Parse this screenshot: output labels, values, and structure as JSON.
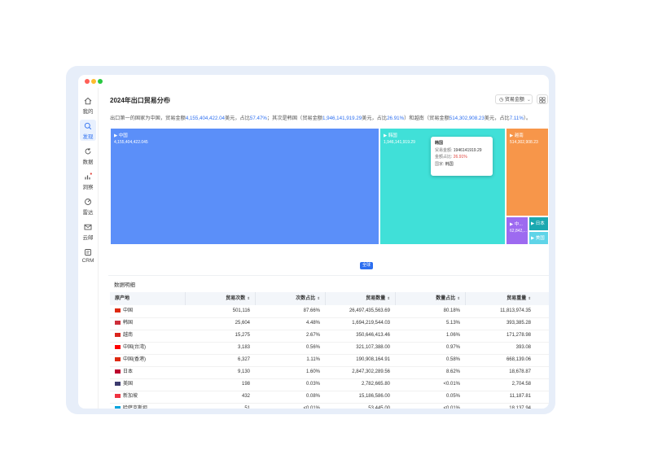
{
  "window": {
    "dots": [
      "#ff5f57",
      "#febc2e",
      "#28c840"
    ]
  },
  "sidebar": {
    "items": [
      {
        "label": "我的",
        "icon": "home-icon"
      },
      {
        "label": "发现",
        "icon": "search-icon",
        "active": true
      },
      {
        "label": "数据",
        "icon": "refresh-icon"
      },
      {
        "label": "洞察",
        "icon": "bar-chart-icon",
        "badge": true
      },
      {
        "label": "雷达",
        "icon": "radar-icon"
      },
      {
        "label": "云邮",
        "icon": "mail-icon"
      },
      {
        "label": "CRM",
        "icon": "crm-icon"
      }
    ]
  },
  "header": {
    "title": "2024年出口贸易分布",
    "select_label": "贸易金额",
    "summary_parts": [
      {
        "t": "出口第一的国家为中国，贸易金额",
        "hl": false
      },
      {
        "t": "4,155,404,422.04",
        "hl": true
      },
      {
        "t": "美元，占比",
        "hl": false
      },
      {
        "t": "57.47%",
        "hl": true
      },
      {
        "t": "；其次是韩国（贸易金额",
        "hl": false
      },
      {
        "t": "1,946,141,919.29",
        "hl": true
      },
      {
        "t": "美元，占比",
        "hl": false
      },
      {
        "t": "26.91%",
        "hl": true
      },
      {
        "t": "）和越南（贸易金额",
        "hl": false
      },
      {
        "t": "514,302,908.23",
        "hl": true
      },
      {
        "t": "美元，占比",
        "hl": false
      },
      {
        "t": "7.11%",
        "hl": true
      },
      {
        "t": "）。",
        "hl": false
      }
    ]
  },
  "treemap": {
    "tiles": [
      {
        "name": "▶ 中国",
        "value": "4,155,404,422.045",
        "color": "#5b8ff9"
      },
      {
        "name": "▶ 韩国",
        "value": "1,946,141,919.29",
        "color": "#40e0d8"
      },
      {
        "name": "▶ 越南",
        "value": "514,302,908.23",
        "color": "#f7964a"
      },
      {
        "name": "▶ 中...",
        "value": "62,842,...",
        "color": "#9d6af0"
      },
      {
        "name": "▶ 日本",
        "value": "",
        "color": "#1aa8b0"
      },
      {
        "name": "▶ 美国",
        "value": "",
        "color": "#5fd4e8"
      }
    ],
    "tooltip": {
      "title": "韩国",
      "amount_label": "贸易金额:",
      "amount": "1946141919.29",
      "share_label": "金额占比:",
      "share": "26.91%",
      "country_label": "国家:",
      "country": "韩国"
    },
    "badge": "全球"
  },
  "table": {
    "title": "数据明细",
    "columns": [
      "原产地",
      "贸易次数",
      "次数占比",
      "贸易数量",
      "数量占比",
      "贸易重量"
    ],
    "rows": [
      {
        "flag": "#de2910",
        "cells": [
          "中国",
          "501,116",
          "87.66%",
          "26,497,435,563.69",
          "80.18%",
          "11,813,974.35"
        ]
      },
      {
        "flag": "#cd2e3a",
        "cells": [
          "韩国",
          "25,604",
          "4.48%",
          "1,694,219,544.03",
          "5.13%",
          "393,385.28"
        ]
      },
      {
        "flag": "#da251d",
        "cells": [
          "越南",
          "15,275",
          "2.67%",
          "350,646,413.46",
          "1.06%",
          "171,278.98"
        ]
      },
      {
        "flag": "#fe0000",
        "cells": [
          "中国(台湾)",
          "3,183",
          "0.56%",
          "321,107,388.00",
          "0.97%",
          "393.08"
        ]
      },
      {
        "flag": "#de2910",
        "cells": [
          "中国(香港)",
          "6,327",
          "1.11%",
          "190,908,164.91",
          "0.58%",
          "668,139.06"
        ]
      },
      {
        "flag": "#bc002d",
        "cells": [
          "日本",
          "9,130",
          "1.60%",
          "2,847,302,289.56",
          "8.62%",
          "18,678.87"
        ]
      },
      {
        "flag": "#3c3b6e",
        "cells": [
          "美国",
          "198",
          "0.03%",
          "2,782,665.80",
          "<0.01%",
          "2,704.58"
        ]
      },
      {
        "flag": "#ef3340",
        "cells": [
          "新加坡",
          "432",
          "0.08%",
          "15,186,586.00",
          "0.05%",
          "11,187.81"
        ]
      },
      {
        "flag": "#00a3dd",
        "cells": [
          "哈萨克斯坦",
          "51",
          "<0.01%",
          "53,445.00",
          "<0.01%",
          "18,137.94"
        ]
      }
    ]
  }
}
